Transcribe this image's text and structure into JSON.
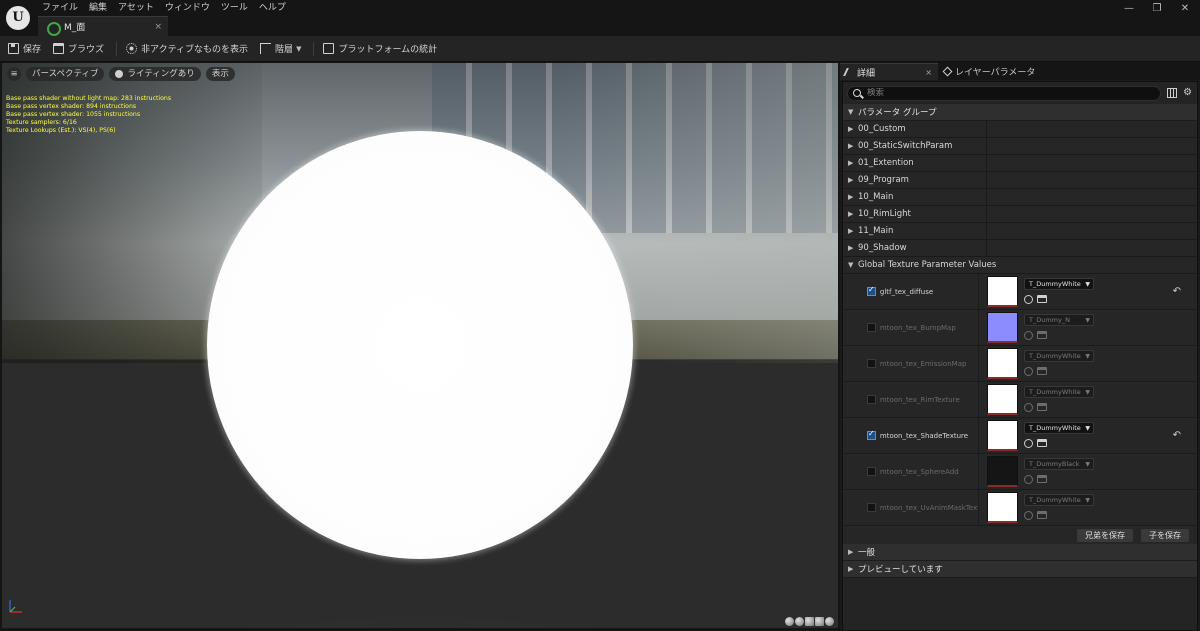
{
  "window": {
    "menu": [
      "ファイル",
      "編集",
      "アセット",
      "ウィンドウ",
      "ツール",
      "ヘルプ"
    ],
    "tab_title": "M_面",
    "tab_close": "×",
    "controls": [
      "—",
      "❐",
      "✕"
    ],
    "logo": "U"
  },
  "toolbar": {
    "save": "保存",
    "browse": "ブラウズ",
    "hide_inactive": "非アクティブなものを表示",
    "hierarchy": "階層",
    "platform_stats": "プラットフォームの統計"
  },
  "viewport": {
    "menu_glyph": "≡",
    "perspective": "パースペクティブ",
    "lighting": "ライティングあり",
    "show": "表示",
    "stats": [
      "Base pass shader without light map: 283 instructions",
      "Base pass vertex shader: 894 instructions",
      "Base pass vertex shader: 1055 instructions",
      "Texture samplers: 6/16",
      "Texture Lookups (Est.): VS(4), PS(6)"
    ]
  },
  "panel": {
    "details_tab": "詳細",
    "details_close": "×",
    "layers_tab": "レイヤーパラメータ",
    "search_placeholder": "検索",
    "param_group_header": "パラメータ グループ",
    "groups": [
      "00_Custom",
      "00_StaticSwitchParam",
      "01_Extention",
      "09_Program",
      "10_Main",
      "10_RimLight",
      "11_Main",
      "90_Shadow"
    ],
    "global_texture_header": "Global Texture Parameter Values",
    "textures": [
      {
        "name": "gltf_tex_diffuse",
        "value": "T_DummyWhite",
        "enabled": true,
        "thumb_color": "#ffffff"
      },
      {
        "name": "mtoon_tex_BumpMap",
        "value": "T_Dummy_N",
        "enabled": false,
        "thumb_color": "#8c8cff"
      },
      {
        "name": "mtoon_tex_EmissionMap",
        "value": "T_DummyWhite",
        "enabled": false,
        "thumb_color": "#ffffff"
      },
      {
        "name": "mtoon_tex_RimTexture",
        "value": "T_DummyWhite",
        "enabled": false,
        "thumb_color": "#ffffff"
      },
      {
        "name": "mtoon_tex_ShadeTexture",
        "value": "T_DummyWhite",
        "enabled": true,
        "thumb_color": "#ffffff"
      },
      {
        "name": "mtoon_tex_SphereAdd",
        "value": "T_DummyBlack",
        "enabled": false,
        "thumb_color": "#151515"
      },
      {
        "name": "mtoon_tex_UvAnimMaskText...",
        "value": "T_DummyWhite",
        "enabled": false,
        "thumb_color": "#ffffff"
      }
    ],
    "save_sibling": "兄弟を保存",
    "save_child": "子を保存",
    "general_header": "一般",
    "preview_header": "プレビューしています"
  },
  "colors": {
    "stats_text": "#ffff40",
    "checkbox_on": "#1d4f8a",
    "panel_bg": "#242424"
  }
}
